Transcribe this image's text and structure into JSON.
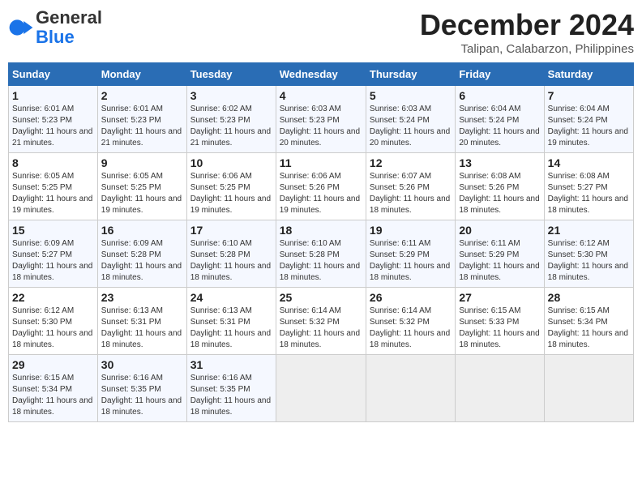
{
  "header": {
    "logo_general": "General",
    "logo_blue": "Blue",
    "title": "December 2024",
    "subtitle": "Talipan, Calabarzon, Philippines"
  },
  "calendar": {
    "days_of_week": [
      "Sunday",
      "Monday",
      "Tuesday",
      "Wednesday",
      "Thursday",
      "Friday",
      "Saturday"
    ],
    "weeks": [
      [
        {
          "day": 1,
          "sunrise": "6:01 AM",
          "sunset": "5:23 PM",
          "daylight": "11 hours and 21 minutes."
        },
        {
          "day": 2,
          "sunrise": "6:01 AM",
          "sunset": "5:23 PM",
          "daylight": "11 hours and 21 minutes."
        },
        {
          "day": 3,
          "sunrise": "6:02 AM",
          "sunset": "5:23 PM",
          "daylight": "11 hours and 21 minutes."
        },
        {
          "day": 4,
          "sunrise": "6:03 AM",
          "sunset": "5:23 PM",
          "daylight": "11 hours and 20 minutes."
        },
        {
          "day": 5,
          "sunrise": "6:03 AM",
          "sunset": "5:24 PM",
          "daylight": "11 hours and 20 minutes."
        },
        {
          "day": 6,
          "sunrise": "6:04 AM",
          "sunset": "5:24 PM",
          "daylight": "11 hours and 20 minutes."
        },
        {
          "day": 7,
          "sunrise": "6:04 AM",
          "sunset": "5:24 PM",
          "daylight": "11 hours and 19 minutes."
        }
      ],
      [
        {
          "day": 8,
          "sunrise": "6:05 AM",
          "sunset": "5:25 PM",
          "daylight": "11 hours and 19 minutes."
        },
        {
          "day": 9,
          "sunrise": "6:05 AM",
          "sunset": "5:25 PM",
          "daylight": "11 hours and 19 minutes."
        },
        {
          "day": 10,
          "sunrise": "6:06 AM",
          "sunset": "5:25 PM",
          "daylight": "11 hours and 19 minutes."
        },
        {
          "day": 11,
          "sunrise": "6:06 AM",
          "sunset": "5:26 PM",
          "daylight": "11 hours and 19 minutes."
        },
        {
          "day": 12,
          "sunrise": "6:07 AM",
          "sunset": "5:26 PM",
          "daylight": "11 hours and 18 minutes."
        },
        {
          "day": 13,
          "sunrise": "6:08 AM",
          "sunset": "5:26 PM",
          "daylight": "11 hours and 18 minutes."
        },
        {
          "day": 14,
          "sunrise": "6:08 AM",
          "sunset": "5:27 PM",
          "daylight": "11 hours and 18 minutes."
        }
      ],
      [
        {
          "day": 15,
          "sunrise": "6:09 AM",
          "sunset": "5:27 PM",
          "daylight": "11 hours and 18 minutes."
        },
        {
          "day": 16,
          "sunrise": "6:09 AM",
          "sunset": "5:28 PM",
          "daylight": "11 hours and 18 minutes."
        },
        {
          "day": 17,
          "sunrise": "6:10 AM",
          "sunset": "5:28 PM",
          "daylight": "11 hours and 18 minutes."
        },
        {
          "day": 18,
          "sunrise": "6:10 AM",
          "sunset": "5:28 PM",
          "daylight": "11 hours and 18 minutes."
        },
        {
          "day": 19,
          "sunrise": "6:11 AM",
          "sunset": "5:29 PM",
          "daylight": "11 hours and 18 minutes."
        },
        {
          "day": 20,
          "sunrise": "6:11 AM",
          "sunset": "5:29 PM",
          "daylight": "11 hours and 18 minutes."
        },
        {
          "day": 21,
          "sunrise": "6:12 AM",
          "sunset": "5:30 PM",
          "daylight": "11 hours and 18 minutes."
        }
      ],
      [
        {
          "day": 22,
          "sunrise": "6:12 AM",
          "sunset": "5:30 PM",
          "daylight": "11 hours and 18 minutes."
        },
        {
          "day": 23,
          "sunrise": "6:13 AM",
          "sunset": "5:31 PM",
          "daylight": "11 hours and 18 minutes."
        },
        {
          "day": 24,
          "sunrise": "6:13 AM",
          "sunset": "5:31 PM",
          "daylight": "11 hours and 18 minutes."
        },
        {
          "day": 25,
          "sunrise": "6:14 AM",
          "sunset": "5:32 PM",
          "daylight": "11 hours and 18 minutes."
        },
        {
          "day": 26,
          "sunrise": "6:14 AM",
          "sunset": "5:32 PM",
          "daylight": "11 hours and 18 minutes."
        },
        {
          "day": 27,
          "sunrise": "6:15 AM",
          "sunset": "5:33 PM",
          "daylight": "11 hours and 18 minutes."
        },
        {
          "day": 28,
          "sunrise": "6:15 AM",
          "sunset": "5:34 PM",
          "daylight": "11 hours and 18 minutes."
        }
      ],
      [
        {
          "day": 29,
          "sunrise": "6:15 AM",
          "sunset": "5:34 PM",
          "daylight": "11 hours and 18 minutes."
        },
        {
          "day": 30,
          "sunrise": "6:16 AM",
          "sunset": "5:35 PM",
          "daylight": "11 hours and 18 minutes."
        },
        {
          "day": 31,
          "sunrise": "6:16 AM",
          "sunset": "5:35 PM",
          "daylight": "11 hours and 18 minutes."
        },
        null,
        null,
        null,
        null
      ]
    ]
  }
}
